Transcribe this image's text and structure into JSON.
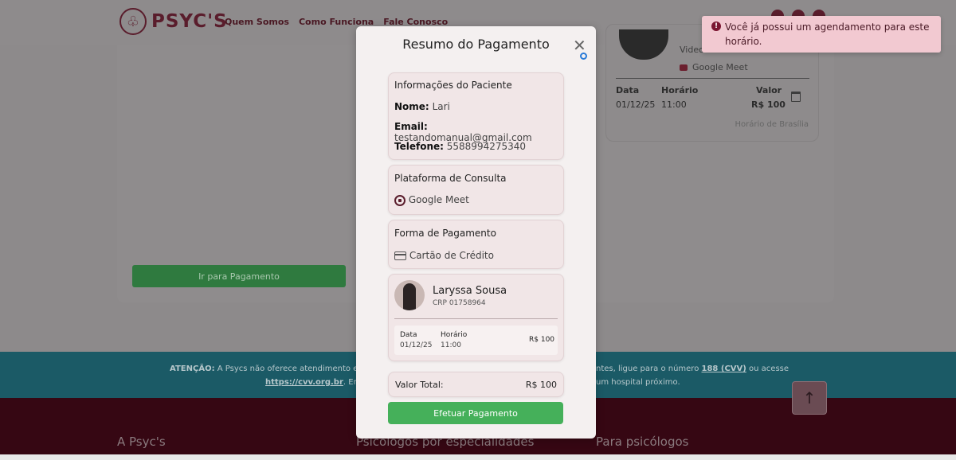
{
  "brand": {
    "name": "PSYC'S"
  },
  "nav": {
    "items": [
      "Quem Somos",
      "Como Funciona",
      "Fale Conosco"
    ]
  },
  "background": {
    "pay_button": "Ir para Pagamento",
    "side_card": {
      "video_label": "Video",
      "meet_label": "Google Meet",
      "col_date": "Data",
      "col_time": "Horário",
      "col_value": "Valor",
      "date": "01/12/25",
      "time": "11:00",
      "value": "R$ 100",
      "timezone": "Horário de Brasília"
    },
    "attention_label": "ATENÇÃO:",
    "attention_text_1": "A Psycs não oferece atendimento e",
    "attention_text_2": "ntes, ligue para o número",
    "attention_number": "188 (CVV)",
    "attention_text_3": "ou acesse",
    "attention_link": "https://cvv.org.br",
    "attention_text_4": ". Em",
    "attention_text_5": "um hospital próximo.",
    "footer_cols": [
      "A Psyc's",
      "Psicólogos por especialidades",
      "Para psicólogos"
    ]
  },
  "modal": {
    "title": "Resumo do Pagamento",
    "patient": {
      "section_title": "Informações do Paciente",
      "name_label": "Nome:",
      "name": "Lari",
      "email_label": "Email:",
      "email": "testandomanual@gmail.com",
      "phone_label": "Telefone:",
      "phone": "5588994275340"
    },
    "platform": {
      "section_title": "Plataforma de Consulta",
      "value": "Google Meet"
    },
    "payment": {
      "section_title": "Forma de Pagamento",
      "value": "Cartão de Crédito"
    },
    "psychologist": {
      "name": "Laryssa Sousa",
      "crp": "CRP 01758964",
      "col_date": "Data",
      "col_time": "Horário",
      "date": "01/12/25",
      "time": "11:00",
      "price": "R$ 100"
    },
    "total": {
      "label": "Valor Total:",
      "value": "R$ 100"
    },
    "submit_label": "Efetuar Pagamento"
  },
  "toast": {
    "message": "Você já possui um agendamento para este horário."
  },
  "colors": {
    "brand": "#5a1d2c",
    "success": "#45b05a",
    "toast_bg": "#f2c9d1",
    "teal_band": "#1b5a66"
  }
}
